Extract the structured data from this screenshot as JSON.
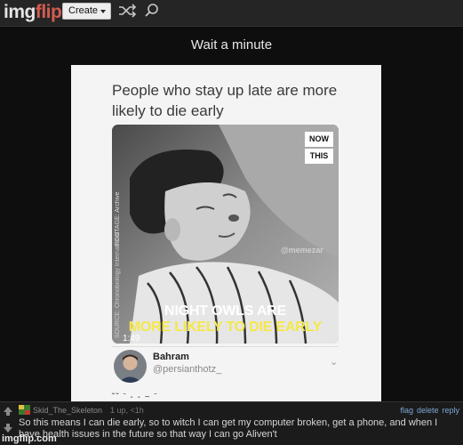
{
  "nav": {
    "logo_part1": "img",
    "logo_part2": "flip",
    "create_label": "Create",
    "shuffle_icon": "shuffle-icon",
    "search_icon": "search-icon"
  },
  "meme": {
    "title": "Wait a minute",
    "tweet_text": "People who stay up late are more likely to die early",
    "badge_now": "NOW",
    "badge_this": "THIS",
    "footage_credit": "FOOTAGE: Archive",
    "source_credit": "SOURCE: Chronobiology International",
    "watermark": "@memezar",
    "caption_line1": "NIGHT OWLS ARE",
    "caption_line2": "MORE LIKELY TO DIE EARLY",
    "duration": "1:49",
    "author_name": "Bahram",
    "author_handle": "@persianthotz_",
    "cutoff_text": "˘ˇ ˉ ‐ ‐ ~ ˉ"
  },
  "comment": {
    "username": "Skid_The_Skeleton",
    "meta": "1 up, <1h",
    "action_flag": "flag",
    "action_delete": "delete",
    "action_reply": "reply",
    "text": "So this means I can die early, so to witch I can get my computer broken, get a phone, and when I have health issues in the future so that way I can go Aliven't",
    "site_mark": "imgflip.com"
  },
  "colors": {
    "background": "#0e0e0e",
    "topbar": "#252525",
    "logo_accent": "#d25b50",
    "link": "#7ea7d8",
    "caption_yellow": "#f5e84a"
  }
}
